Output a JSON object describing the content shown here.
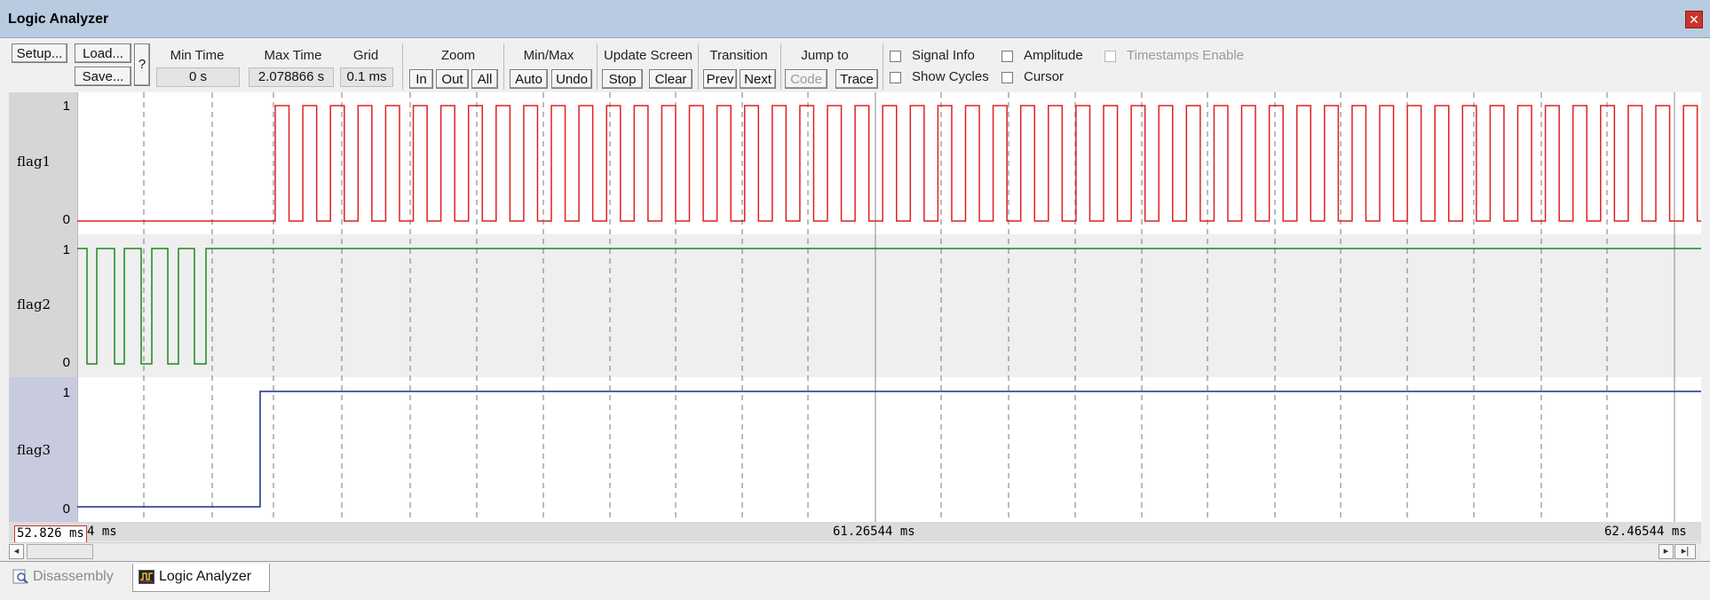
{
  "window": {
    "title": "Logic Analyzer",
    "close_icon": "close-icon"
  },
  "toolbar": {
    "setup_label": "Setup...",
    "load_label": "Load...",
    "save_label": "Save...",
    "help_label": "?",
    "min_time": {
      "label": "Min Time",
      "value": "0 s"
    },
    "max_time": {
      "label": "Max Time",
      "value": "2.078866 s"
    },
    "grid": {
      "label": "Grid",
      "value": "0.1 ms"
    },
    "zoom": {
      "label": "Zoom",
      "in": "In",
      "out": "Out",
      "all": "All"
    },
    "minmax": {
      "label": "Min/Max",
      "auto": "Auto",
      "undo": "Undo"
    },
    "update_screen": {
      "label": "Update Screen",
      "stop": "Stop",
      "clear": "Clear"
    },
    "transition": {
      "label": "Transition",
      "prev": "Prev",
      "next": "Next"
    },
    "jump_to": {
      "label": "Jump to",
      "code": "Code",
      "trace": "Trace"
    },
    "checkboxes": {
      "signal_info": "Signal Info",
      "show_cycles": "Show Cycles",
      "amplitude": "Amplitude",
      "cursor": "Cursor",
      "timestamps_enable": "Timestamps Enable"
    }
  },
  "signals": [
    {
      "name": "flag1",
      "high": "1",
      "low": "0",
      "color": "#e02020"
    },
    {
      "name": "flag2",
      "high": "1",
      "low": "0",
      "color": "#1a8a1a"
    },
    {
      "name": "flag3",
      "high": "1",
      "low": "0",
      "color": "#1f2a8a"
    }
  ],
  "timeline": {
    "cursor_value": "52.826 ms",
    "left_label": "4 ms",
    "mid_label": "61.26544 ms",
    "right_label": "62.46544 ms"
  },
  "tabs": [
    {
      "label": "Disassembly",
      "icon": "disassembly-icon",
      "active": false
    },
    {
      "label": "Logic Analyzer",
      "icon": "logic-analyzer-icon",
      "active": true
    }
  ]
}
